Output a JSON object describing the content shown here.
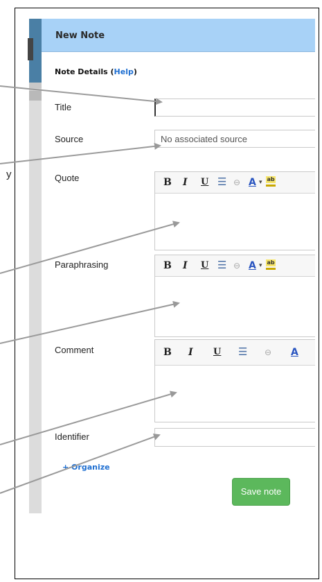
{
  "dialog": {
    "title": "New Note",
    "section_heading": "Note Details",
    "help_link": "Help"
  },
  "fields": {
    "title_label": "Title",
    "title_value": "",
    "source_label": "Source",
    "source_placeholder": "No associated source",
    "quote_label": "Quote",
    "paraphrasing_label": "Paraphrasing",
    "comment_label": "Comment",
    "identifier_label": "Identifier",
    "identifier_value": ""
  },
  "toolbar": {
    "bold": "B",
    "italic": "I",
    "underline": "U",
    "list": "☰",
    "link": "⊖",
    "font_color": "A",
    "caret": "▾"
  },
  "actions": {
    "organize": "+ Organize",
    "save": "Save note"
  },
  "background_text": {
    "stray_letter": "y"
  },
  "colors": {
    "header": "#a8d2f7",
    "link": "#1f6fd1",
    "save_button": "#5cb85c"
  }
}
